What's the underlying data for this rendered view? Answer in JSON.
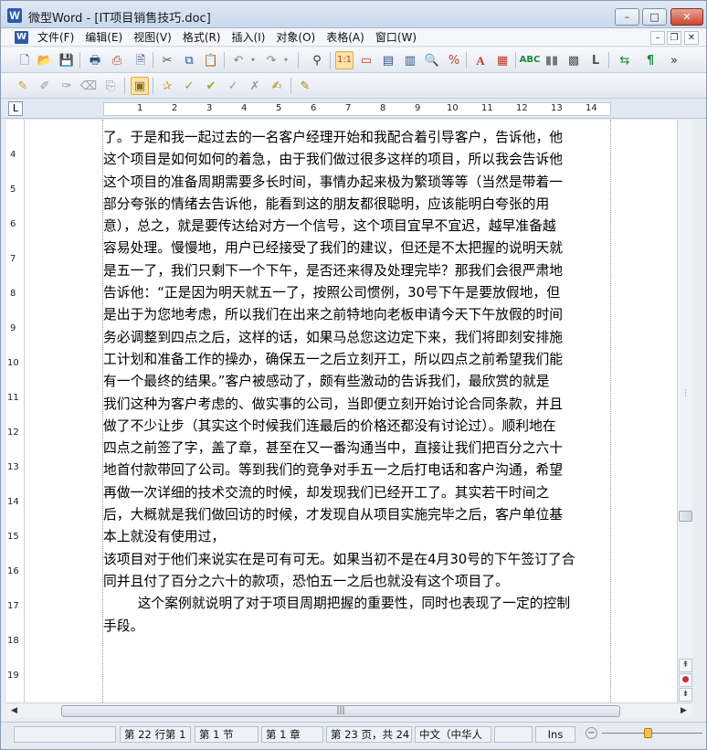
{
  "window": {
    "title": "微型Word - [IT项目销售技巧.doc]",
    "app_icon": "W",
    "minimize_label": "–",
    "maximize_label": "□",
    "close_label": "✕"
  },
  "menu": {
    "items": [
      {
        "label": "文件(F)"
      },
      {
        "label": "编辑(E)"
      },
      {
        "label": "视图(V)"
      },
      {
        "label": "格式(R)"
      },
      {
        "label": "插入(I)"
      },
      {
        "label": "对象(O)"
      },
      {
        "label": "表格(A)"
      },
      {
        "label": "窗口(W)"
      }
    ],
    "mdi_minimize": "–",
    "mdi_restore": "❐",
    "mdi_close": "✕"
  },
  "toolbar1": {
    "icons": [
      "new-document",
      "open-folder",
      "save",
      "print",
      "pdf-export",
      "cut",
      "copy",
      "paste",
      "undo",
      "redo",
      "find",
      "page-layout",
      "view-mode-1",
      "view-mode-2",
      "view-mode-3",
      "zoom",
      "special-char",
      "font",
      "format-paint",
      "spellcheck",
      "columns",
      "shading",
      "border-style",
      "binoculars-replace",
      "paragraph-mark",
      "more"
    ]
  },
  "toolbar2": {
    "icons": [
      "highlight",
      "edit-pen",
      "delete-pen",
      "eraser",
      "approve",
      "object-select",
      "comment-star",
      "check-1",
      "check-2",
      "check-3",
      "check-4",
      "notes",
      "track-changes"
    ]
  },
  "ruler": {
    "tab_selector": "L",
    "numbers": [
      "1",
      "2",
      "3",
      "4",
      "5",
      "6",
      "7",
      "8",
      "9",
      "10",
      "11",
      "12",
      "13",
      "14"
    ],
    "vertical_numbers": [
      "4",
      "5",
      "6",
      "7",
      "8",
      "9",
      "10",
      "11",
      "12",
      "13",
      "14",
      "15",
      "16",
      "17",
      "18",
      "19"
    ]
  },
  "document": {
    "lines": [
      "了。于是和我一起过去的一名客户经理开始和我配合着引导客户，告诉他，他",
      "这个项目是如何如何的着急，由于我们做过很多这样的项目，所以我会告诉他",
      "这个项目的准备周期需要多长时间，事情办起来极为繁琐等等（当然是带着一",
      "部分夸张的情绪去告诉他，能看到这的朋友都很聪明，应该能明白夸张的用",
      "意），总之，就是要传达给对方一个信号，这个项目宜早不宜迟，越早准备越",
      "容易处理。慢慢地，用户已经接受了我们的建议，但还是不太把握的说明天就",
      "是五一了，我们只剩下一个下午，是否还来得及处理完毕？那我们会很严肃地",
      "告诉他：“正是因为明天就五一了，按照公司惯例，30号下午是要放假地，但",
      "是出于为您地考虑，所以我们在出来之前特地向老板申请今天下午放假的时间",
      "务必调整到四点之后，这样的话，如果马总您这边定下来，我们将即刻安排施",
      "工计划和准备工作的操办，确保五一之后立刻开工，所以四点之前希望我们能",
      "有一个最终的结果。”客户被感动了，颇有些激动的告诉我们，最欣赏的就是",
      "我们这种为客户考虑的、做实事的公司，当即便立刻开始讨论合同条款，并且",
      "做了不少让步（其实这个时候我们连最后的价格还都没有讨论过）。顺利地在",
      "四点之前签了字，盖了章，甚至在又一番沟通当中，直接让我们把百分之六十",
      "地首付款带回了公司。等到我们的竞争对手五一之后打电话和客户沟通，希望",
      "再做一次详细的技术交流的时候，却发现我们已经开工了。其实若干时间之",
      "后，大概就是我们做回访的时候，才发现自从项目实施完毕之后，客户单位基",
      "本上就没有使用过，",
      "该项目对于他们来说实在是可有可无。如果当初不是在4月30号的下午签订了合",
      "同并且付了百分之六十的款项，恐怕五一之后也就没有这个项目了。",
      "        这个案例就说明了对于项目周期把握的重要性，同时也表现了一定的控制",
      "手段。"
    ]
  },
  "scrollbars": {
    "up_arrow": "▲",
    "down_arrow": "▼",
    "prev_page": "⇞",
    "browse_object": "●",
    "next_page": "⇟",
    "left_arrow": "◀",
    "right_arrow": "▶",
    "h_grip": "|||"
  },
  "status": {
    "cell0": "",
    "line_col": "第 22 行第 1",
    "section": "第 1 节",
    "chapter": "第 1 章",
    "page": "第 23 页，共 24",
    "language": "中文（中华人",
    "blank": "",
    "ins": "Ins",
    "zoom_minus": "−"
  },
  "colors": {
    "title_gradient_top": "#dfe9f5",
    "accent_blue": "#2b5aa8",
    "close_red": "#c9462e",
    "zoom_knob": "#f4c24a"
  }
}
